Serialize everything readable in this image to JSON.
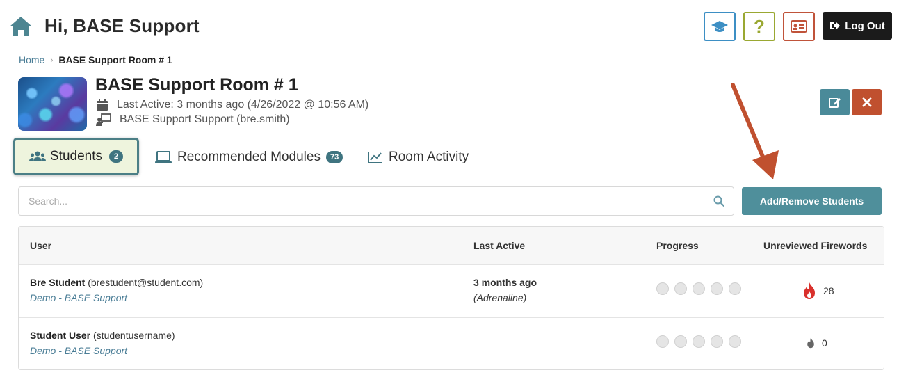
{
  "header": {
    "greeting": "Hi, BASE Support",
    "help_label": "?",
    "logout_label": "Log Out"
  },
  "breadcrumb": {
    "home": "Home",
    "current": "BASE Support Room # 1"
  },
  "room": {
    "title": "BASE Support Room # 1",
    "last_active": "Last Active: 3 months ago (4/26/2022 @ 10:56 AM)",
    "instructor": "BASE Support Support (bre.smith)"
  },
  "tabs": [
    {
      "label": "Students",
      "count": "2",
      "icon": "users-icon"
    },
    {
      "label": "Recommended Modules",
      "count": "73",
      "icon": "laptop-icon"
    },
    {
      "label": "Room Activity",
      "icon": "chart-line-icon"
    }
  ],
  "search": {
    "placeholder": "Search...",
    "value": ""
  },
  "add_remove_label": "Add/Remove Students",
  "table": {
    "columns": [
      "User",
      "Last Active",
      "Progress",
      "Unreviewed Firewords"
    ],
    "rows": [
      {
        "name": "Bre Student",
        "handle": "(brestudent@student.com)",
        "org": "Demo - BASE Support",
        "last_active": "3 months ago",
        "last_active_sub": "(Adrenaline)",
        "progress_filled": 0,
        "fireworks": "28",
        "fire_color": "#d9302c"
      },
      {
        "name": "Student User",
        "handle": "(studentusername)",
        "org": "Demo - BASE Support",
        "last_active": "",
        "last_active_sub": "",
        "progress_filled": 0,
        "fireworks": "0",
        "fire_color": "#666666"
      }
    ]
  },
  "colors": {
    "accent": "#4f8f9b",
    "danger": "#c0502f",
    "link": "#4a7d96",
    "annotation_arrow": "#c0502f"
  }
}
